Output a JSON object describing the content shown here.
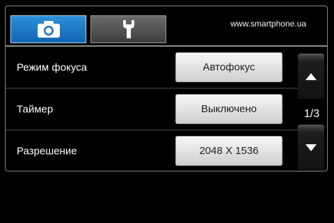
{
  "header": {
    "tabs": [
      {
        "name": "camera",
        "icon": "camera-icon",
        "active": true
      },
      {
        "name": "settings",
        "icon": "wrench-icon",
        "active": false
      }
    ],
    "site_text": "www.smartphone.ua"
  },
  "settings": [
    {
      "label": "Режим фокуса",
      "value": "Автофокус"
    },
    {
      "label": "Таймер",
      "value": "Выключено"
    },
    {
      "label": "Разрешение",
      "value": "2048 X 1536"
    }
  ],
  "pager": {
    "indicator": "1/3",
    "up_icon": "arrow-up-icon",
    "down_icon": "arrow-down-icon"
  },
  "colors": {
    "active_tab": "#1f7cc7",
    "inactive_tab": "#555555",
    "background": "#000000"
  }
}
